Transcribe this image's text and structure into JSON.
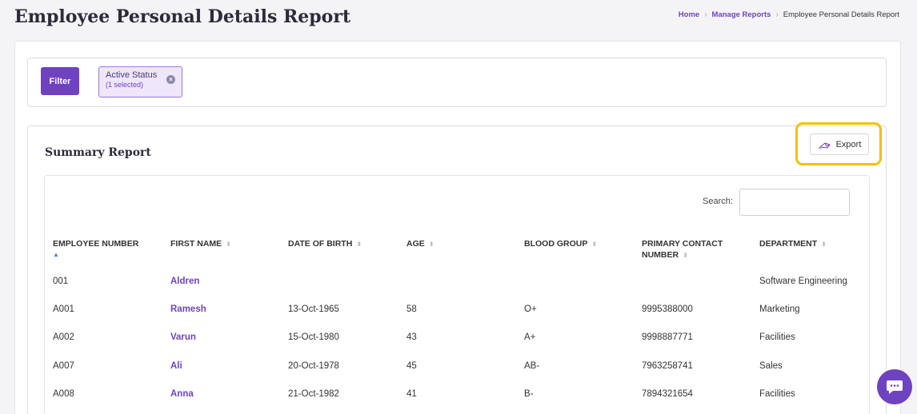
{
  "header": {
    "title": "Employee Personal Details Report",
    "breadcrumb": [
      "Home",
      "Manage Reports",
      "Employee Personal Details Report"
    ]
  },
  "filters": {
    "filter_label": "Filter",
    "chip_label": "Active Status",
    "chip_sub": "(1 selected)"
  },
  "report": {
    "title": "Summary Report",
    "export_label": "Export",
    "search_label": "Search:",
    "search_value": ""
  },
  "table": {
    "columns": [
      "EMPLOYEE NUMBER",
      "FIRST NAME",
      "DATE OF BIRTH",
      "AGE",
      "BLOOD GROUP",
      "PRIMARY CONTACT NUMBER",
      "DEPARTMENT"
    ],
    "rows": [
      [
        "001",
        "Aldren",
        "",
        "",
        "",
        "",
        "Software Engineering"
      ],
      [
        "A001",
        "Ramesh",
        "13-Oct-1965",
        "58",
        "O+",
        "9995388000",
        "Marketing"
      ],
      [
        "A002",
        "Varun",
        "15-Oct-1980",
        "43",
        "A+",
        "9998887771",
        "Facilities"
      ],
      [
        "A007",
        "Ali",
        "20-Oct-1978",
        "45",
        "AB-",
        "7963258741",
        "Sales"
      ],
      [
        "A008",
        "Anna",
        "21-Oct-1982",
        "41",
        "B-",
        "7894321654",
        "Facilities"
      ]
    ]
  },
  "colors": {
    "accent": "#6f42c1",
    "highlight": "#f2c200"
  },
  "icons": {
    "export": "export-icon",
    "chip_close": "close-circle-icon",
    "chat": "chat-icon",
    "sort": "sort-icon"
  }
}
